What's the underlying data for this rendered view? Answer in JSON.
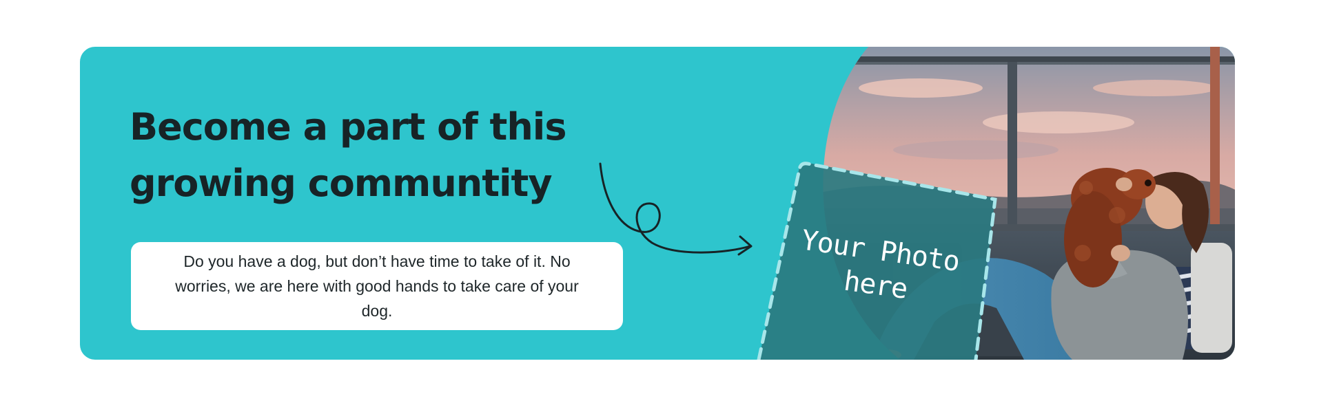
{
  "banner": {
    "headline": "Become a part of this growing communtity",
    "description": "Do you have a dog, but don’t have time to take of it. No worries, we are here with good hands to take care of your dog.",
    "photo_placeholder_label": "Your Photo here",
    "photo_alt": "Woman on a rooftop couch kissing her fluffy brown dog at sunset"
  },
  "icons": {
    "arrow": "curly-arrow-icon"
  },
  "colors": {
    "banner_background": "#2ec5cd",
    "headline_text": "#172326",
    "placeholder_panel": "#2a7a80",
    "dashed_border": "#a8e6ea"
  }
}
